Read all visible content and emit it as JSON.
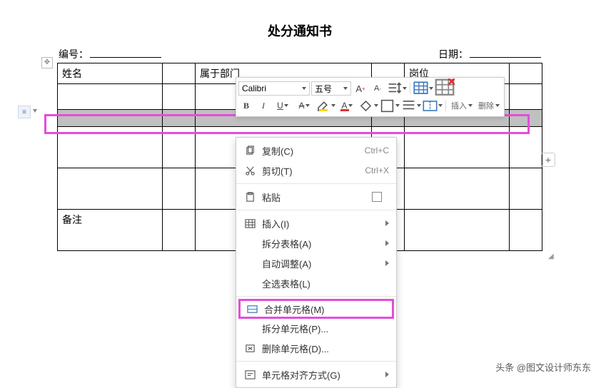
{
  "doc": {
    "title": "处分通知书",
    "field_number_label": "编号：",
    "field_date_label": "日期：",
    "col_name": "姓名",
    "col_dept": "属于部门",
    "col_post": "岗位",
    "row_remark": "备注"
  },
  "toolbar": {
    "font": "Calibri",
    "size": "五号",
    "insert_label": "插入",
    "delete_label": "删除"
  },
  "context_menu": {
    "copy": "复制(C)",
    "copy_sc": "Ctrl+C",
    "cut": "剪切(T)",
    "cut_sc": "Ctrl+X",
    "paste": "粘贴",
    "insert": "插入(I)",
    "split_table": "拆分表格(A)",
    "auto_fit": "自动调整(A)",
    "select_table": "全选表格(L)",
    "merge_cells": "合并单元格(M)",
    "split_cells": "拆分单元格(P)...",
    "delete_cells": "删除单元格(D)...",
    "cell_align": "单元格对齐方式(G)"
  },
  "watermark": "头条 @图文设计师东东"
}
